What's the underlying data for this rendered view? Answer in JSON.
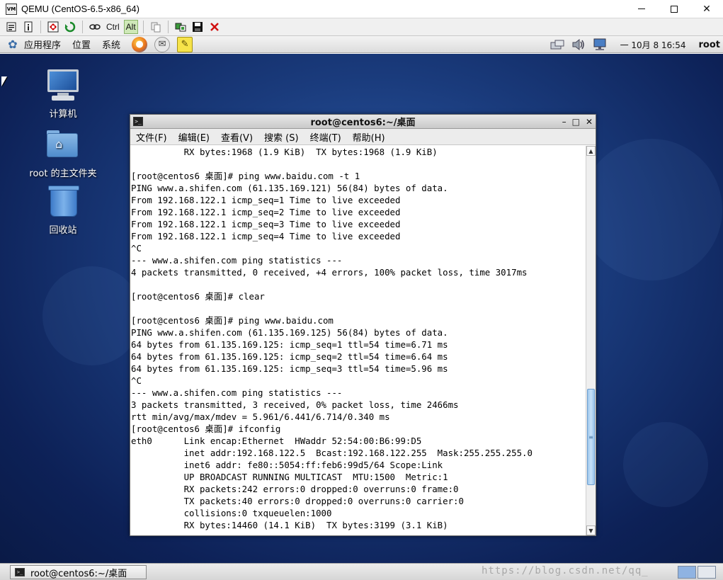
{
  "host_window": {
    "app_icon_text": "VM",
    "title": "QEMU (CentOS-6.5-x86_64)",
    "min_icon": "minimize-icon",
    "max_icon": "maximize-icon",
    "close_icon": "close-icon",
    "close_glyph": "✕"
  },
  "qemu_toolbar": {
    "ctrl_label": "Ctrl",
    "alt_label": "Alt",
    "icons": [
      "properties-icon",
      "info-icon",
      "fullscreen-icon",
      "reset-icon",
      "usb-icon",
      "copy-icon",
      "screenshot-icon",
      "save-icon",
      "quit-icon"
    ],
    "alt_color": "#cfe8b8",
    "quit_color": "#d01010"
  },
  "gnome_panel": {
    "menus": [
      "应用程序",
      "位置",
      "系统"
    ],
    "clock": "一 10月  8 16:54",
    "user": "root",
    "launchers": [
      "firefox-icon",
      "mail-icon",
      "notes-icon"
    ],
    "tray": [
      "network-manager-icon",
      "volume-icon",
      "network-icon"
    ]
  },
  "desktop": {
    "icons": [
      {
        "label": "计算机",
        "icon": "computer-icon"
      },
      {
        "label": "root 的主文件夹",
        "icon": "home-folder-icon"
      },
      {
        "label": "回收站",
        "icon": "trash-icon"
      }
    ]
  },
  "terminal": {
    "title": "root@centos6:~/桌面",
    "title_icon_text": ">_",
    "controls": [
      "–",
      "□",
      "✕"
    ],
    "menu": [
      "文件(F)",
      "编辑(E)",
      "查看(V)",
      "搜索 (S)",
      "终端(T)",
      "帮助(H)"
    ],
    "scroll_up": "▲",
    "scroll_down": "▼",
    "scroll_grip": "≡",
    "lines": [
      "          RX bytes:1968 (1.9 KiB)  TX bytes:1968 (1.9 KiB)",
      "",
      "[root@centos6 桌面]# ping www.baidu.com -t 1",
      "PING www.a.shifen.com (61.135.169.121) 56(84) bytes of data.",
      "From 192.168.122.1 icmp_seq=1 Time to live exceeded",
      "From 192.168.122.1 icmp_seq=2 Time to live exceeded",
      "From 192.168.122.1 icmp_seq=3 Time to live exceeded",
      "From 192.168.122.1 icmp_seq=4 Time to live exceeded",
      "^C",
      "--- www.a.shifen.com ping statistics ---",
      "4 packets transmitted, 0 received, +4 errors, 100% packet loss, time 3017ms",
      "",
      "[root@centos6 桌面]# clear",
      "",
      "[root@centos6 桌面]# ping www.baidu.com",
      "PING www.a.shifen.com (61.135.169.125) 56(84) bytes of data.",
      "64 bytes from 61.135.169.125: icmp_seq=1 ttl=54 time=6.71 ms",
      "64 bytes from 61.135.169.125: icmp_seq=2 ttl=54 time=6.64 ms",
      "64 bytes from 61.135.169.125: icmp_seq=3 ttl=54 time=5.96 ms",
      "^C",
      "--- www.a.shifen.com ping statistics ---",
      "3 packets transmitted, 3 received, 0% packet loss, time 2466ms",
      "rtt min/avg/max/mdev = 5.961/6.441/6.714/0.340 ms",
      "[root@centos6 桌面]# ifconfig",
      "eth0      Link encap:Ethernet  HWaddr 52:54:00:B6:99:D5",
      "          inet addr:192.168.122.5  Bcast:192.168.122.255  Mask:255.255.255.0",
      "          inet6 addr: fe80::5054:ff:feb6:99d5/64 Scope:Link",
      "          UP BROADCAST RUNNING MULTICAST  MTU:1500  Metric:1",
      "          RX packets:242 errors:0 dropped:0 overruns:0 frame:0",
      "          TX packets:40 errors:0 dropped:0 overruns:0 carrier:0",
      "          collisions:0 txqueuelen:1000",
      "          RX bytes:14460 (14.1 KiB)  TX bytes:3199 (3.1 KiB)"
    ]
  },
  "taskbar": {
    "item_label": "root@centos6:~/桌面",
    "item_icon_text": ">_",
    "watermark": "https://blog.csdn.net/qq_"
  }
}
